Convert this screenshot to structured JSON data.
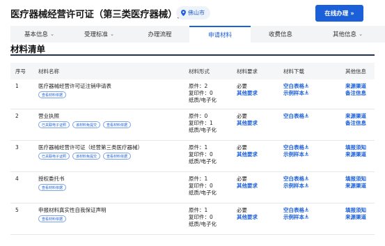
{
  "header": {
    "title": "医疗器械经营许可证（第三类医疗器械）注销",
    "location": "佛山市",
    "online_button": "在线办理 »"
  },
  "tabs": [
    {
      "label": "基本信息",
      "dropdown": true,
      "active": false
    },
    {
      "label": "受理标准",
      "dropdown": true,
      "active": false
    },
    {
      "label": "办理流程",
      "dropdown": false,
      "active": false
    },
    {
      "label": "申请材料",
      "dropdown": false,
      "active": true
    },
    {
      "label": "收费信息",
      "dropdown": false,
      "active": false
    },
    {
      "label": "其他信息",
      "dropdown": true,
      "active": false
    }
  ],
  "section": {
    "title": "材料清单"
  },
  "table": {
    "headers": [
      "序号",
      "材料名称",
      "材料形式",
      "材料要求",
      "材料下载",
      "其他信息"
    ],
    "rows": [
      {
        "index": "1",
        "name": "医疗器械经营许可证注销申请表",
        "tags": [
          "查看材料依据"
        ],
        "form": [
          "原件：2",
          "复印件：0",
          "纸质/电子化"
        ],
        "requirement": "必要",
        "requirement_link": "其他要求",
        "downloads": [
          "空白表格",
          "示例样本"
        ],
        "other": [
          "来源渠道",
          "备注信息"
        ]
      },
      {
        "index": "2",
        "name": "营业执照",
        "tags": [
          "已关联电子证照",
          "该材料免提交",
          "查看材料依据"
        ],
        "form": [
          "原件：0",
          "复印件：1",
          "纸质/电子化"
        ],
        "requirement": "必要",
        "requirement_link": "其他要求",
        "downloads": [
          "空白表格"
        ],
        "other": [
          "来源渠道",
          "备注信息"
        ]
      },
      {
        "index": "3",
        "name": "医疗器械经营许可证（经营第三类医疗器械）",
        "tags": [
          "已关联电子证照",
          "该材料免提交",
          "查看材料依据"
        ],
        "form": [
          "原件：1",
          "复印件：0",
          "纸质/电子化"
        ],
        "requirement": "必要",
        "requirement_link": "其他要求",
        "downloads": [
          "空白表格",
          "示例样本"
        ],
        "other": [
          "填报须知",
          "来源渠道"
        ]
      },
      {
        "index": "4",
        "name": "授权委托书",
        "tags": [
          "查看材料依据"
        ],
        "form": [
          "原件：1",
          "复印件：0",
          "纸质/电子化"
        ],
        "requirement": "必要",
        "requirement_link": "其他要求",
        "downloads": [
          "空白表格",
          "示例样本"
        ],
        "other": [
          "填报须知",
          "来源渠道"
        ]
      },
      {
        "index": "5",
        "name": "申报材料真实性自我保证声明",
        "tags": [
          "查看材料依据"
        ],
        "form": [
          "原件：1",
          "复印件：0",
          "纸质/电子化"
        ],
        "requirement": "必要",
        "requirement_link": "其他要求",
        "downloads": [
          "空白表格",
          "示例样本"
        ],
        "other": [
          "填报须知",
          "来源渠道"
        ]
      }
    ]
  },
  "icons": {
    "location": "location-pin-icon",
    "download": "download-icon",
    "dropdown": "chevron-down-icon"
  },
  "colors": {
    "accent": "#1b5fd9",
    "tab_bar": "#f3f4f6",
    "section_rule": "#23324a"
  }
}
